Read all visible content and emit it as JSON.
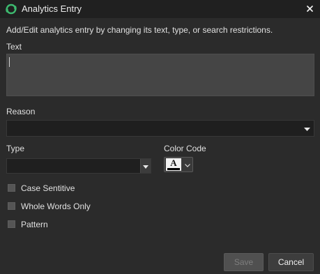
{
  "window": {
    "title": "Analytics Entry",
    "logo_icon": "app-logo-icon",
    "close_icon": "close-icon"
  },
  "form": {
    "description": "Add/Edit analytics entry by changing its text, type, or search restrictions.",
    "text_label": "Text",
    "text_value": "",
    "reason_label": "Reason",
    "reason_value": "",
    "type_label": "Type",
    "type_value": "",
    "color_code_label": "Color Code",
    "color_code_letter": "A",
    "color_code_value": "#000000"
  },
  "options": [
    {
      "label": "Case Sentitive",
      "checked": false
    },
    {
      "label": "Whole Words Only",
      "checked": false
    },
    {
      "label": "Pattern",
      "checked": false
    }
  ],
  "buttons": {
    "save_label": "Save",
    "save_enabled": false,
    "cancel_label": "Cancel"
  },
  "colors": {
    "accent_green": "#3dba6f",
    "background": "#2b2b2b",
    "titlebar": "#202020"
  }
}
